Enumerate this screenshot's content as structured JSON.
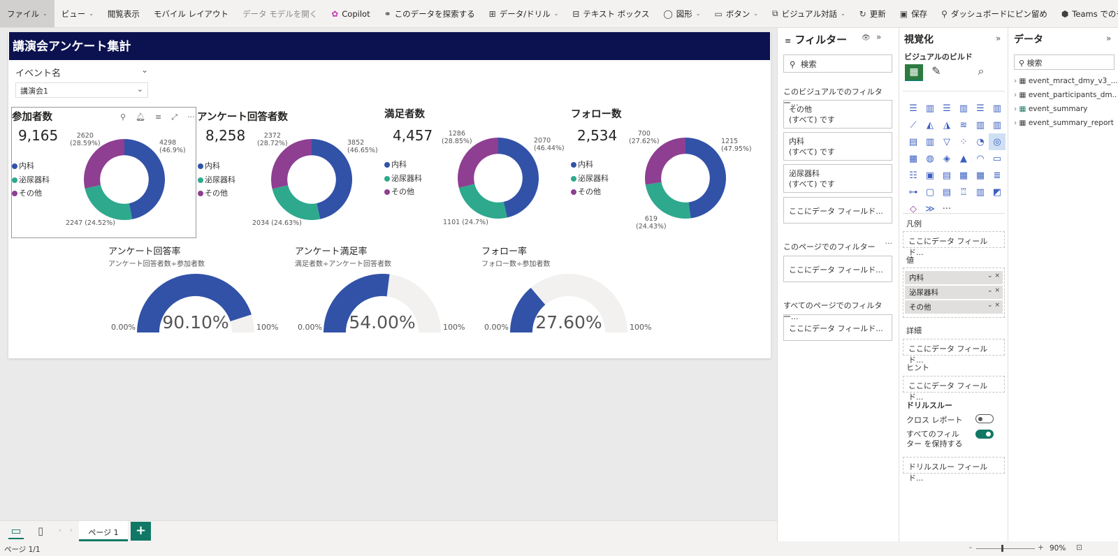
{
  "ribbon": {
    "items": [
      {
        "label": "ファイル",
        "chevron": true,
        "icon": ""
      },
      {
        "label": "ビュー",
        "chevron": true,
        "icon": ""
      },
      {
        "label": "閲覧表示",
        "chevron": false,
        "icon": ""
      },
      {
        "label": "モバイル レイアウト",
        "chevron": false,
        "icon": ""
      },
      {
        "label": "データ モデルを開く",
        "chevron": false,
        "icon": ""
      },
      {
        "label": "Copilot",
        "chevron": false,
        "icon": "copilot-icon"
      },
      {
        "label": "このデータを探索する",
        "chevron": false,
        "icon": "binoculars-icon"
      },
      {
        "label": "データ/ドリル",
        "chevron": true,
        "icon": "drill-icon"
      },
      {
        "label": "テキスト ボックス",
        "chevron": false,
        "icon": "textbox-icon"
      },
      {
        "label": "図形",
        "chevron": true,
        "icon": "shapes-icon"
      },
      {
        "label": "ボタン",
        "chevron": true,
        "icon": "button-icon"
      },
      {
        "label": "ビジュアル対話",
        "chevron": true,
        "icon": "interact-icon"
      },
      {
        "label": "更新",
        "chevron": false,
        "icon": "refresh-icon"
      },
      {
        "label": "保存",
        "chevron": false,
        "icon": "save-icon"
      },
      {
        "label": "ダッシュボードにピン留め",
        "chevron": false,
        "icon": "pin-icon"
      },
      {
        "label": "Teams でのチャット",
        "chevron": false,
        "icon": "teams-icon"
      },
      {
        "label": "···",
        "chevron": false,
        "icon": ""
      }
    ]
  },
  "report": {
    "title": "講演会アンケート集計",
    "slicer": {
      "label": "イベント名",
      "value": "講演会1"
    }
  },
  "colors": {
    "internal": "#3252a8",
    "urology": "#2ea98d",
    "other": "#8e3f92",
    "header": "#0c1250",
    "gauge_fill": "#3252a8",
    "gauge_bg": "#f2f1f0",
    "accent": "#117865"
  },
  "legend_labels": [
    "内科",
    "泌尿器科",
    "その他"
  ],
  "chart_data": [
    {
      "type": "pie",
      "title": "参加者数",
      "total": "9,165",
      "categories": [
        "内科",
        "泌尿器科",
        "その他"
      ],
      "values": [
        4298,
        2247,
        2620
      ],
      "labels": [
        "4298\n(46.9%)",
        "2247 (24.52%)",
        "2620\n(28.59%)"
      ]
    },
    {
      "type": "pie",
      "title": "アンケート回答者数",
      "total": "8,258",
      "categories": [
        "内科",
        "泌尿器科",
        "その他"
      ],
      "values": [
        3852,
        2034,
        2372
      ],
      "labels": [
        "3852\n(46.65%)",
        "2034 (24.63%)",
        "2372\n(28.72%)"
      ]
    },
    {
      "type": "pie",
      "title": "満足者数",
      "total": "4,457",
      "categories": [
        "内科",
        "泌尿器科",
        "その他"
      ],
      "values": [
        2070,
        1101,
        1286
      ],
      "labels": [
        "2070\n(46.44%)",
        "1101 (24.7%)",
        "1286\n(28.85%)"
      ]
    },
    {
      "type": "pie",
      "title": "フォロー数",
      "total": "2,534",
      "categories": [
        "内科",
        "泌尿器科",
        "その他"
      ],
      "values": [
        1215,
        619,
        700
      ],
      "labels": [
        "1215\n(47.95%)",
        "619\n(24.43%)",
        "700\n(27.62%)"
      ]
    }
  ],
  "gauges": [
    {
      "title": "アンケート回答率",
      "subtitle": "アンケート回答者数÷参加者数",
      "value": 0.901,
      "display": "90.10%",
      "min": "0.00%",
      "max": "100%"
    },
    {
      "title": "アンケート満足率",
      "subtitle": "満足者数÷アンケート回答者数",
      "value": 0.54,
      "display": "54.00%",
      "min": "0.00%",
      "max": "100%"
    },
    {
      "title": "フォロー率",
      "subtitle": "フォロー数÷参加者数",
      "value": 0.276,
      "display": "27.60%",
      "min": "0.00%",
      "max": "100%"
    }
  ],
  "filters": {
    "title": "フィルター",
    "search_placeholder": "検索",
    "visual_section": "このビジュアルでのフィルター...",
    "visual_filters": [
      {
        "name": "その他",
        "state": "(すべて) です"
      },
      {
        "name": "内科",
        "state": "(すべて) です"
      },
      {
        "name": "泌尿器科",
        "state": "(すべて) です"
      }
    ],
    "drop_here": "ここにデータ フィールド...",
    "page_section": "このページでのフィルター",
    "all_section": "すべてのページでのフィルター..."
  },
  "viz": {
    "title": "視覚化",
    "build": "ビジュアルのビルド",
    "legend": "凡例",
    "values": "値",
    "value_items": [
      "内科",
      "泌尿器科",
      "その他"
    ],
    "details": "詳細",
    "tooltips": "ヒント",
    "drop_here": "ここにデータ フィールド...",
    "drillthrough": "ドリルスルー",
    "cross_report": "クロス レポート",
    "keep_filters": "すべてのフィルター を保持する",
    "drill_field": "ドリルスルー フィールド..."
  },
  "data_pane": {
    "title": "データ",
    "search_placeholder": "検索",
    "tables": [
      "event_mract_dmy_v3_...",
      "event_participants_dm...",
      "event_summary",
      "event_summary_report"
    ]
  },
  "tabs": {
    "page": "ページ 1",
    "add": "+"
  },
  "status": {
    "page": "ページ 1/1",
    "zoom": "90%"
  }
}
